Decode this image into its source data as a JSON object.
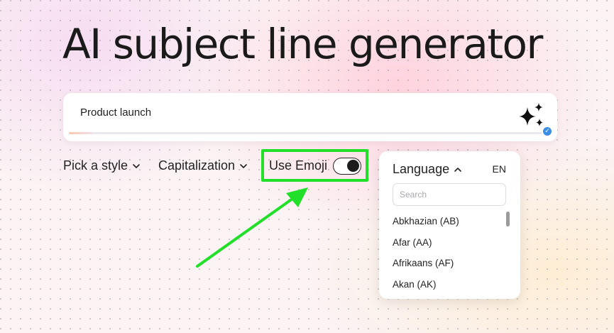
{
  "page": {
    "title": "AI subject line generator"
  },
  "input": {
    "value": "Product launch"
  },
  "options": {
    "style_label": "Pick a style",
    "capitalization_label": "Capitalization",
    "emoji_label": "Use Emoji",
    "emoji_enabled": true
  },
  "language": {
    "label": "Language",
    "selected_code": "EN",
    "search_placeholder": "Search",
    "items": [
      {
        "label": "Abkhazian (AB)"
      },
      {
        "label": "Afar (AA)"
      },
      {
        "label": "Afrikaans (AF)"
      },
      {
        "label": "Akan (AK)"
      }
    ]
  },
  "colors": {
    "highlight": "#22e02a",
    "badge": "#3a8ee6"
  },
  "icons": {
    "generate": "sparkle-icon",
    "verified": "check-badge-icon",
    "dropdown": "chevron-down-icon",
    "collapse": "chevron-up-icon"
  }
}
